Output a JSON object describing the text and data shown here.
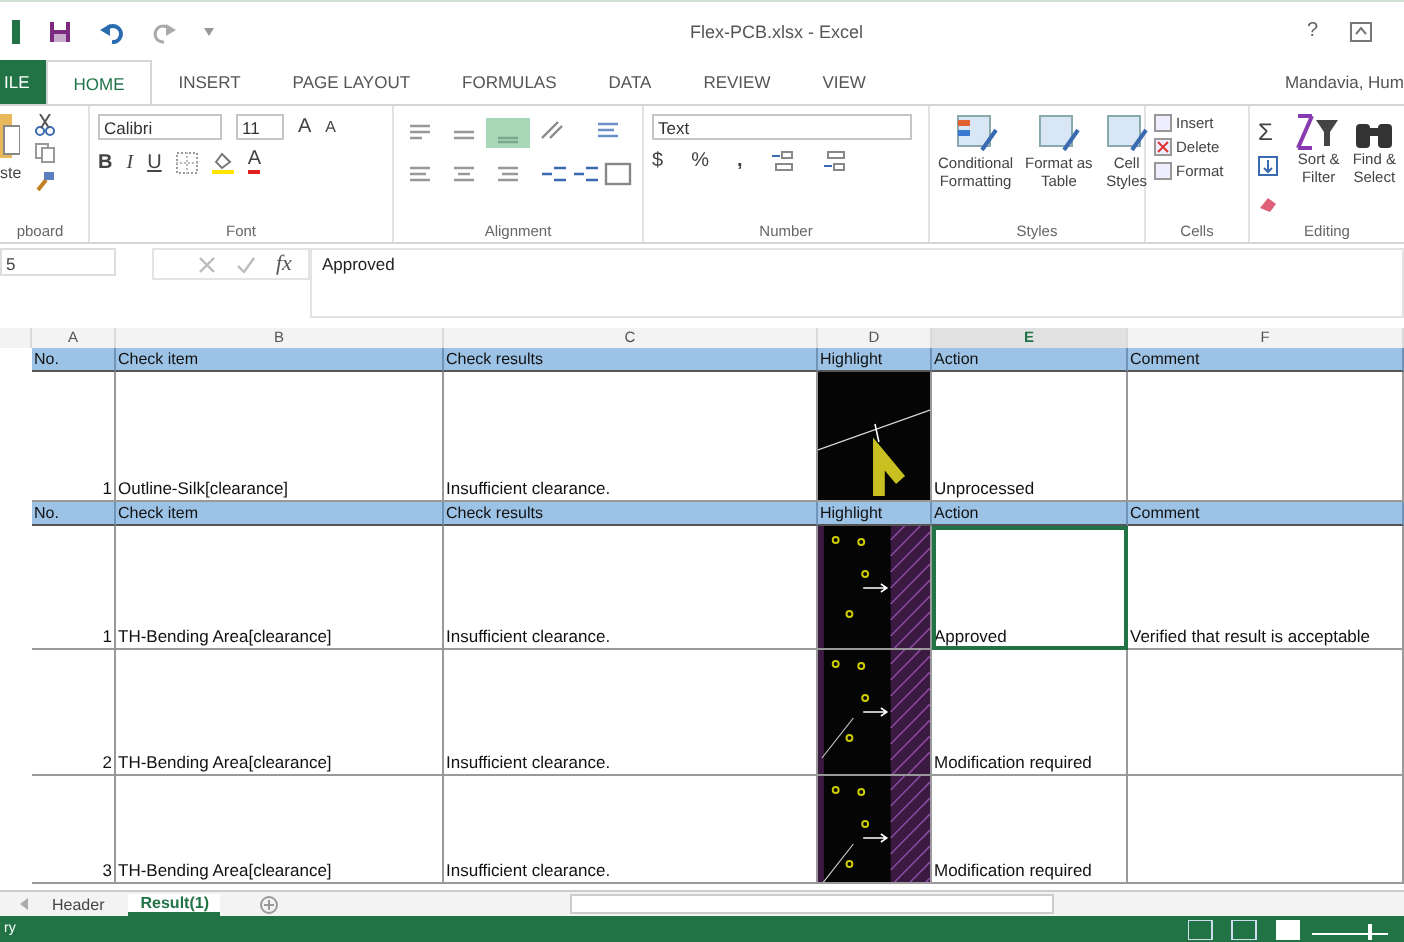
{
  "window": {
    "title": "Flex-PCB.xlsx - Excel",
    "help": "?",
    "user": "Mandavia, Hum"
  },
  "ribbon_tabs": [
    {
      "label": "ILE",
      "kind": "file",
      "selected": false
    },
    {
      "label": "HOME",
      "kind": "tab",
      "selected": true
    },
    {
      "label": "INSERT",
      "kind": "tab",
      "selected": false
    },
    {
      "label": "PAGE LAYOUT",
      "kind": "tab",
      "selected": false
    },
    {
      "label": "FORMULAS",
      "kind": "tab",
      "selected": false
    },
    {
      "label": "DATA",
      "kind": "tab",
      "selected": false
    },
    {
      "label": "REVIEW",
      "kind": "tab",
      "selected": false
    },
    {
      "label": "VIEW",
      "kind": "tab",
      "selected": false
    }
  ],
  "clipboard": {
    "paste": "ste",
    "label": "pboard"
  },
  "font": {
    "name": "Calibri",
    "size": "11",
    "grow": "A",
    "shrink": "A",
    "bold": "B",
    "italic": "I",
    "underline": "U",
    "font_color_button": "A",
    "label": "Font"
  },
  "alignment": {
    "label": "Alignment"
  },
  "number": {
    "format": "Text",
    "currency": "$",
    "percent": "%",
    "comma": ",",
    "label": "Number"
  },
  "styles": {
    "items": [
      {
        "line1": "Conditional",
        "line2": "Formatting"
      },
      {
        "line1": "Format as",
        "line2": "Table"
      },
      {
        "line1": "Cell",
        "line2": "Styles"
      }
    ],
    "label": "Styles"
  },
  "cells": {
    "items": [
      "Insert",
      "Delete",
      "Format"
    ],
    "label": "Cells"
  },
  "editing": {
    "sum": "Σ",
    "items": [
      {
        "line1": "Sort &",
        "line2": "Filter"
      },
      {
        "line1": "Find &",
        "line2": "Select"
      }
    ],
    "label": "Editing"
  },
  "formula_bar": {
    "name_box": "5",
    "fx": "fx",
    "value": "Approved"
  },
  "columns": [
    {
      "letter": "A",
      "selected": false
    },
    {
      "letter": "B",
      "selected": false
    },
    {
      "letter": "C",
      "selected": false
    },
    {
      "letter": "D",
      "selected": false
    },
    {
      "letter": "E",
      "selected": true
    },
    {
      "letter": "F",
      "selected": false
    }
  ],
  "sections": [
    {
      "headers": [
        "No.",
        "Check item",
        "Check results",
        "Highlight",
        "Action",
        "Comment"
      ],
      "rows": [
        {
          "no": "1",
          "item": "Outline-Silk[clearance]",
          "result": "Insufficient clearance.",
          "action": "Unprocessed",
          "selected": false
        }
      ]
    },
    {
      "headers": [
        "No.",
        "Check item",
        "Check results",
        "Highlight",
        "Action",
        "Comment"
      ],
      "rows": [
        {
          "no": "1",
          "item": "TH-Bending Area[clearance]",
          "result": "Insufficient clearance.",
          "action": "Approved",
          "comment": "Verified that result is acceptable",
          "selected": true
        },
        {
          "no": "2",
          "item": "TH-Bending Area[clearance]",
          "result": "Insufficient clearance.",
          "action": "Modification required",
          "selected": false
        },
        {
          "no": "3",
          "item": "TH-Bending Area[clearance]",
          "result": "Insufficient clearance.",
          "action": "Modification required",
          "selected": false
        }
      ]
    }
  ],
  "sheet_tabs": [
    {
      "label": "Header",
      "selected": false
    },
    {
      "label": "Result(1)",
      "selected": true
    }
  ],
  "status_bar": {
    "text": "ry"
  }
}
